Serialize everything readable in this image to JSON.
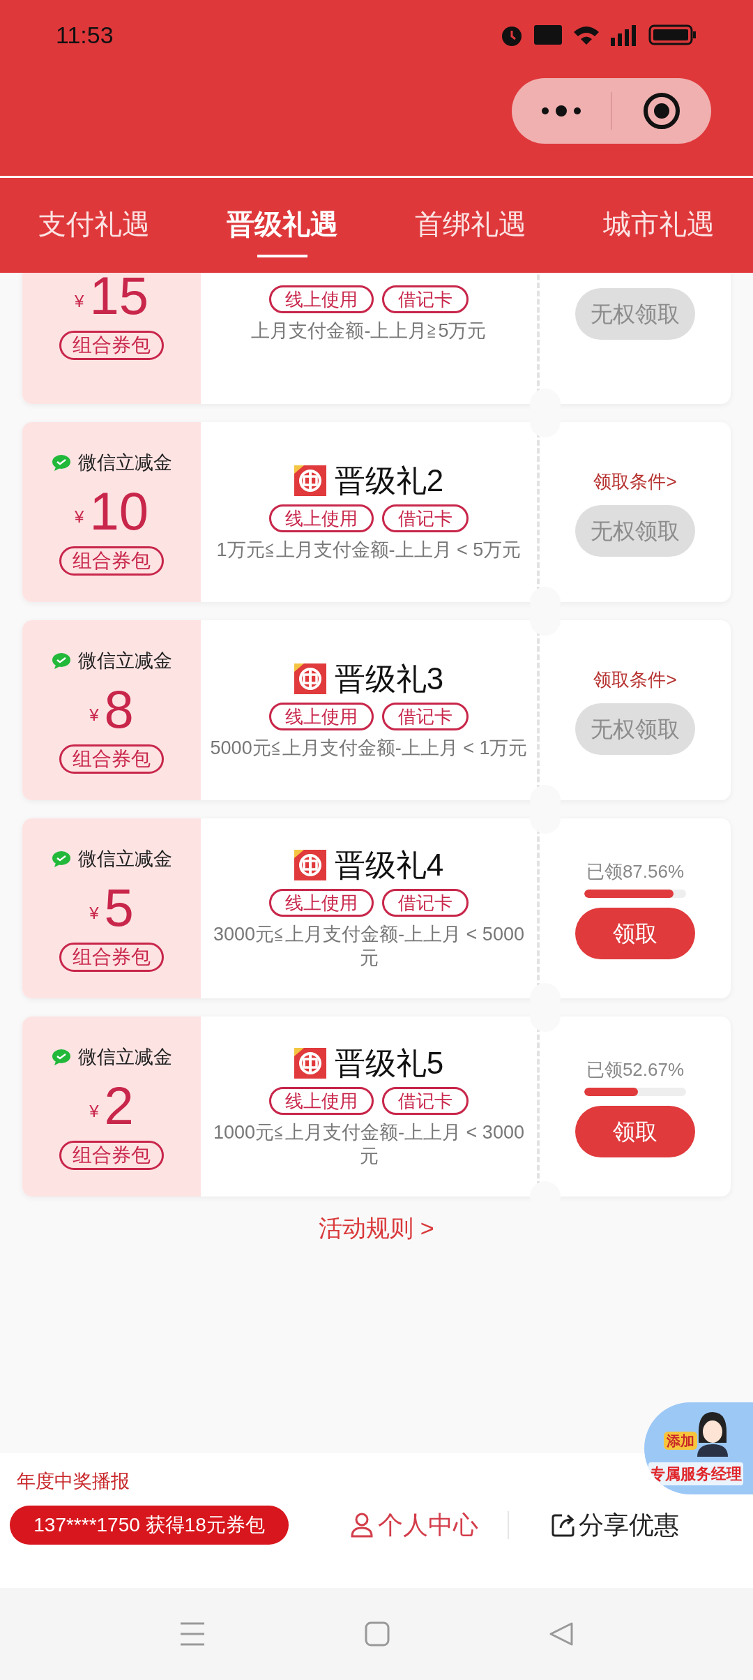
{
  "status_bar": {
    "time": "11:53"
  },
  "tabs": [
    {
      "label": "支付礼遇",
      "selected": false
    },
    {
      "label": "晋级礼遇",
      "selected": true
    },
    {
      "label": "首绑礼遇",
      "selected": false
    },
    {
      "label": "城市礼遇",
      "selected": false
    }
  ],
  "cards": [
    {
      "currency": "¥",
      "amount": "15",
      "bundle": "组合券包",
      "tags": [
        "线上使用",
        "借记卡"
      ],
      "condition": "上月支付金额-上上月≧5万元",
      "button": {
        "label": "无权领取",
        "disabled": true
      }
    },
    {
      "wechat_label": "微信立减金",
      "currency": "¥",
      "amount": "10",
      "bundle": "组合券包",
      "title": "晋级礼2",
      "tags": [
        "线上使用",
        "借记卡"
      ],
      "condition": "1万元≦上月支付金额-上上月 < 5万元",
      "conditions_link": "领取条件>",
      "button": {
        "label": "无权领取",
        "disabled": true
      }
    },
    {
      "wechat_label": "微信立减金",
      "currency": "¥",
      "amount": "8",
      "bundle": "组合券包",
      "title": "晋级礼3",
      "tags": [
        "线上使用",
        "借记卡"
      ],
      "condition": "5000元≦上月支付金额-上上月 < 1万元",
      "conditions_link": "领取条件>",
      "button": {
        "label": "无权领取",
        "disabled": true
      }
    },
    {
      "wechat_label": "微信立减金",
      "currency": "¥",
      "amount": "5",
      "bundle": "组合券包",
      "title": "晋级礼4",
      "tags": [
        "线上使用",
        "借记卡"
      ],
      "condition": "3000元≦上月支付金额-上上月 < 5000元",
      "claimed": "已领87.56%",
      "level": 0.8756,
      "button": {
        "label": "领取",
        "disabled": false
      }
    },
    {
      "wechat_label": "微信立减金",
      "currency": "¥",
      "amount": "2",
      "bundle": "组合券包",
      "title": "晋级礼5",
      "tags": [
        "线上使用",
        "借记卡"
      ],
      "condition": "1000元≦上月支付金额-上上月 < 3000元",
      "claimed": "已领52.67%",
      "level": 0.5267,
      "button": {
        "label": "领取",
        "disabled": false
      }
    }
  ],
  "rules_link": "活动规则 >",
  "manager_badge": {
    "add": "添加",
    "label": "专属服务经理"
  },
  "bottom_bar": {
    "broadcast_title": "年度中奖播报",
    "broadcast": "137****1750 获得18元券包",
    "personal_center": "个人中心",
    "share": "分享优惠"
  }
}
